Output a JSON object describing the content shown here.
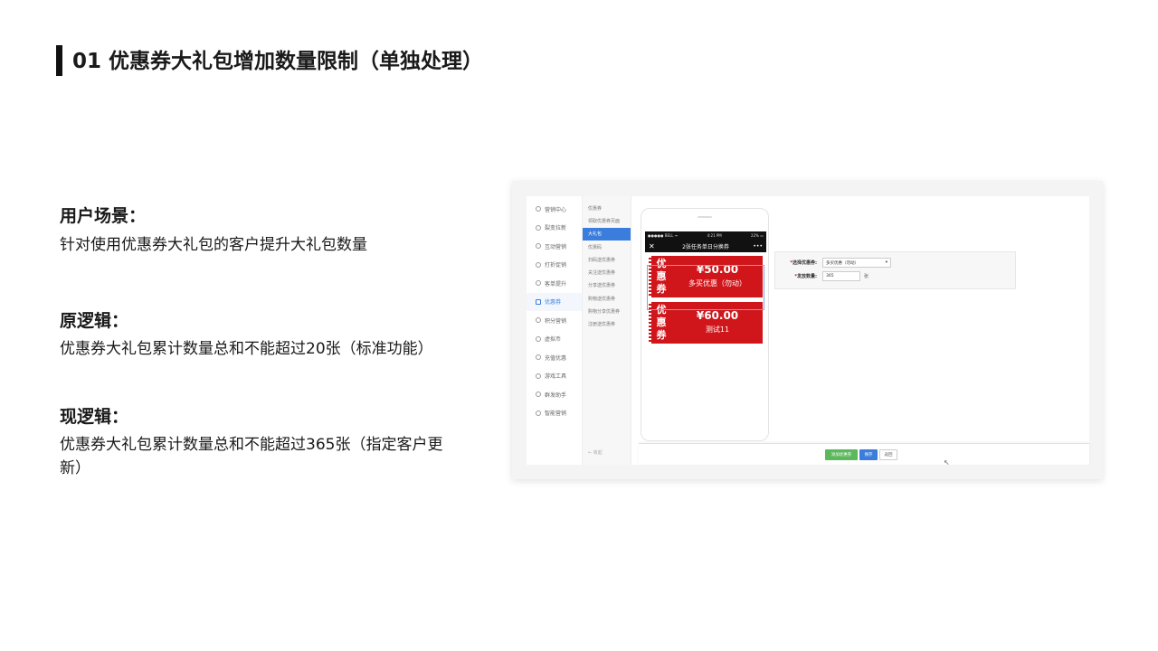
{
  "slide": {
    "title": "01 优惠券大礼包增加数量限制（单独处理）"
  },
  "sections": [
    {
      "heading": "用户场景：",
      "text": "针对使用优惠券大礼包的客户提升大礼包数量"
    },
    {
      "heading": "原逻辑：",
      "text": "优惠券大礼包累计数量总和不能超过20张（标准功能）"
    },
    {
      "heading": "现逻辑：",
      "text": "优惠券大礼包累计数量总和不能超过365张（指定客户更新）"
    }
  ],
  "screenshot": {
    "nav1": [
      "营销中心",
      "裂变拉新",
      "互动营销",
      "打折促销",
      "客单提升",
      "优惠券",
      "积分营销",
      "虚拟币",
      "充值优惠",
      "游戏工具",
      "群发助手",
      "智能营销"
    ],
    "nav1_active": 5,
    "nav2": [
      "优惠券",
      "领取优惠券页面",
      "大礼包",
      "优惠码",
      "扫码送优惠券",
      "关注送优惠券",
      "分享送优惠券",
      "购物送优惠券",
      "购物分享优惠券",
      "注册送优惠券"
    ],
    "nav2_active": 2,
    "nav2_back": "← 收起",
    "phone": {
      "carrier": "●●●●● BELL ᯤ",
      "time": "4:21 PM",
      "battery": "22% ▭",
      "header_title": "2张任务单日分换券",
      "close": "✕",
      "more": "•••",
      "coupons": [
        {
          "label": "优惠券",
          "amount": "¥50.00",
          "desc": "多买优惠（勿动）"
        },
        {
          "label": "优惠券",
          "amount": "¥60.00",
          "desc": "测试11"
        }
      ]
    },
    "form": {
      "select_label": "选择优惠券:",
      "select_value": "多买优惠（勿动）",
      "qty_label": "发放数量:",
      "qty_value": "365",
      "qty_unit": "张"
    },
    "footer": {
      "add_btn": "添加优惠券",
      "save_btn": "保存",
      "back_btn": "返回"
    }
  }
}
